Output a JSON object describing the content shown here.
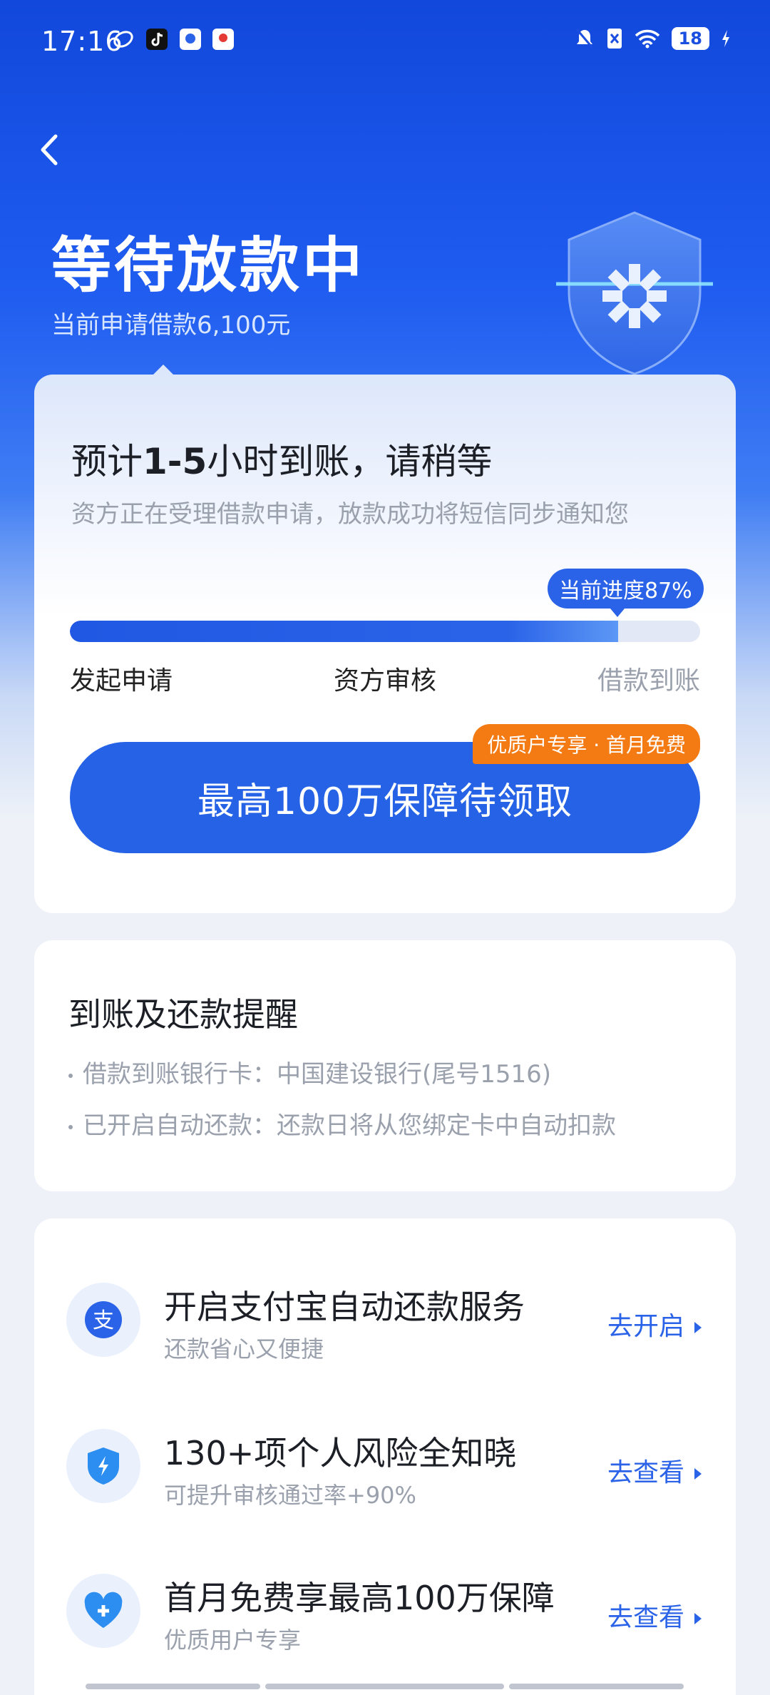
{
  "status_bar": {
    "time": "17:16",
    "battery": "18"
  },
  "header": {
    "title": "等待放款中",
    "subtitle": "当前申请借款6,100元"
  },
  "progress_card": {
    "heading_prefix": "预计",
    "heading_bold": "1-5",
    "heading_suffix": "小时到账，请稍等",
    "description": "资方正在受理借款申请，放款成功将短信同步通知您",
    "progress_label": "当前进度87%",
    "progress_value": 0.87,
    "steps": [
      "发起申请",
      "资方审核",
      "借款到账"
    ],
    "cta_label": "最高100万保障待领取",
    "cta_badge": "优质户专享 · 首月免费"
  },
  "reminder_card": {
    "title": "到账及还款提醒",
    "lines": [
      "借款到账银行卡：中国建设银行(尾号1516)",
      "已开启自动还款：还款日将从您绑定卡中自动扣款"
    ]
  },
  "services": [
    {
      "icon": "alipay-icon",
      "title": "开启支付宝自动还款服务",
      "subtitle": "还款省心又便捷",
      "action": "去开启"
    },
    {
      "icon": "shield-bolt-icon",
      "title": "130+项个人风险全知晓",
      "subtitle": "可提升审核通过率+90%",
      "action": "去查看"
    },
    {
      "icon": "heart-plus-icon",
      "title": "首月免费享最高100万保障",
      "subtitle": "优质用户专享",
      "action": "去查看"
    }
  ],
  "colors": {
    "primary": "#2562e6",
    "accent": "#f47a14",
    "muted": "#9aa1ad"
  }
}
